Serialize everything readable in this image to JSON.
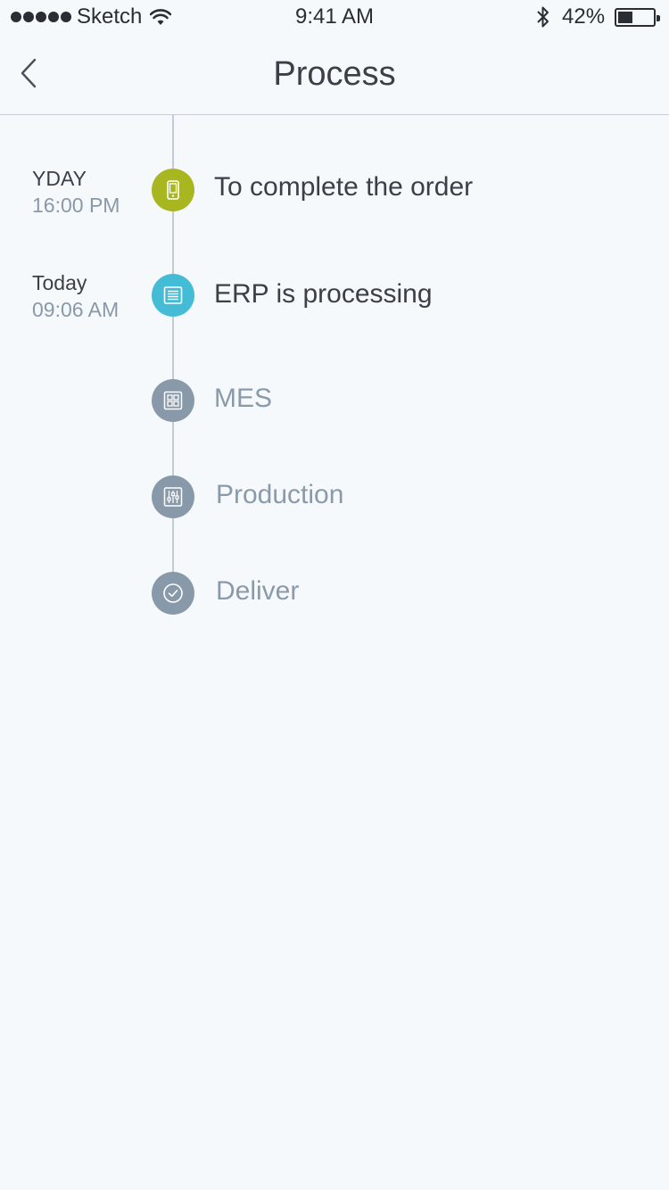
{
  "status_bar": {
    "carrier": "Sketch",
    "time": "9:41 AM",
    "battery": "42%",
    "battery_level": 0.42
  },
  "nav": {
    "title": "Process",
    "back_icon": "chevron-left-icon"
  },
  "colors": {
    "step_done": "#a8b620",
    "step_current": "#45bcd6",
    "step_pending": "#8899aa",
    "timeline": "#c2cad2"
  },
  "steps": [
    {
      "date": "YDAY",
      "time": "16:00 PM",
      "label": "To complete the order",
      "icon": "tablet-icon",
      "state": "done"
    },
    {
      "date": "Today",
      "time": "09:06 AM",
      "label": "ERP is processing",
      "icon": "document-list-icon",
      "state": "current"
    },
    {
      "date": "",
      "time": "",
      "label": "MES",
      "icon": "grid-icon",
      "state": "pending"
    },
    {
      "date": "",
      "time": "",
      "label": "Production",
      "icon": "sliders-icon",
      "state": "pending"
    },
    {
      "date": "",
      "time": "",
      "label": "Deliver",
      "icon": "check-circle-icon",
      "state": "pending"
    }
  ]
}
